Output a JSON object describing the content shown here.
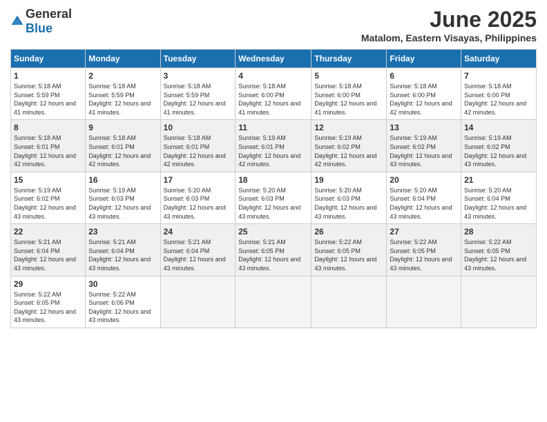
{
  "header": {
    "logo_general": "General",
    "logo_blue": "Blue",
    "month_year": "June 2025",
    "location": "Matalom, Eastern Visayas, Philippines"
  },
  "weekdays": [
    "Sunday",
    "Monday",
    "Tuesday",
    "Wednesday",
    "Thursday",
    "Friday",
    "Saturday"
  ],
  "weeks": [
    [
      {
        "day": "1",
        "sunrise": "5:18 AM",
        "sunset": "5:59 PM",
        "daylight": "12 hours and 41 minutes."
      },
      {
        "day": "2",
        "sunrise": "5:18 AM",
        "sunset": "5:59 PM",
        "daylight": "12 hours and 41 minutes."
      },
      {
        "day": "3",
        "sunrise": "5:18 AM",
        "sunset": "5:59 PM",
        "daylight": "12 hours and 41 minutes."
      },
      {
        "day": "4",
        "sunrise": "5:18 AM",
        "sunset": "6:00 PM",
        "daylight": "12 hours and 41 minutes."
      },
      {
        "day": "5",
        "sunrise": "5:18 AM",
        "sunset": "6:00 PM",
        "daylight": "12 hours and 41 minutes."
      },
      {
        "day": "6",
        "sunrise": "5:18 AM",
        "sunset": "6:00 PM",
        "daylight": "12 hours and 42 minutes."
      },
      {
        "day": "7",
        "sunrise": "5:18 AM",
        "sunset": "6:00 PM",
        "daylight": "12 hours and 42 minutes."
      }
    ],
    [
      {
        "day": "8",
        "sunrise": "5:18 AM",
        "sunset": "6:01 PM",
        "daylight": "12 hours and 42 minutes."
      },
      {
        "day": "9",
        "sunrise": "5:18 AM",
        "sunset": "6:01 PM",
        "daylight": "12 hours and 42 minutes."
      },
      {
        "day": "10",
        "sunrise": "5:18 AM",
        "sunset": "6:01 PM",
        "daylight": "12 hours and 42 minutes."
      },
      {
        "day": "11",
        "sunrise": "5:19 AM",
        "sunset": "6:01 PM",
        "daylight": "12 hours and 42 minutes."
      },
      {
        "day": "12",
        "sunrise": "5:19 AM",
        "sunset": "6:02 PM",
        "daylight": "12 hours and 42 minutes."
      },
      {
        "day": "13",
        "sunrise": "5:19 AM",
        "sunset": "6:02 PM",
        "daylight": "12 hours and 43 minutes."
      },
      {
        "day": "14",
        "sunrise": "5:19 AM",
        "sunset": "6:02 PM",
        "daylight": "12 hours and 43 minutes."
      }
    ],
    [
      {
        "day": "15",
        "sunrise": "5:19 AM",
        "sunset": "6:02 PM",
        "daylight": "12 hours and 43 minutes."
      },
      {
        "day": "16",
        "sunrise": "5:19 AM",
        "sunset": "6:03 PM",
        "daylight": "12 hours and 43 minutes."
      },
      {
        "day": "17",
        "sunrise": "5:20 AM",
        "sunset": "6:03 PM",
        "daylight": "12 hours and 43 minutes."
      },
      {
        "day": "18",
        "sunrise": "5:20 AM",
        "sunset": "6:03 PM",
        "daylight": "12 hours and 43 minutes."
      },
      {
        "day": "19",
        "sunrise": "5:20 AM",
        "sunset": "6:03 PM",
        "daylight": "12 hours and 43 minutes."
      },
      {
        "day": "20",
        "sunrise": "5:20 AM",
        "sunset": "6:04 PM",
        "daylight": "12 hours and 43 minutes."
      },
      {
        "day": "21",
        "sunrise": "5:20 AM",
        "sunset": "6:04 PM",
        "daylight": "12 hours and 43 minutes."
      }
    ],
    [
      {
        "day": "22",
        "sunrise": "5:21 AM",
        "sunset": "6:04 PM",
        "daylight": "12 hours and 43 minutes."
      },
      {
        "day": "23",
        "sunrise": "5:21 AM",
        "sunset": "6:04 PM",
        "daylight": "12 hours and 43 minutes."
      },
      {
        "day": "24",
        "sunrise": "5:21 AM",
        "sunset": "6:04 PM",
        "daylight": "12 hours and 43 minutes."
      },
      {
        "day": "25",
        "sunrise": "5:21 AM",
        "sunset": "6:05 PM",
        "daylight": "12 hours and 43 minutes."
      },
      {
        "day": "26",
        "sunrise": "5:22 AM",
        "sunset": "6:05 PM",
        "daylight": "12 hours and 43 minutes."
      },
      {
        "day": "27",
        "sunrise": "5:22 AM",
        "sunset": "6:05 PM",
        "daylight": "12 hours and 43 minutes."
      },
      {
        "day": "28",
        "sunrise": "5:22 AM",
        "sunset": "6:05 PM",
        "daylight": "12 hours and 43 minutes."
      }
    ],
    [
      {
        "day": "29",
        "sunrise": "5:22 AM",
        "sunset": "6:05 PM",
        "daylight": "12 hours and 43 minutes."
      },
      {
        "day": "30",
        "sunrise": "5:22 AM",
        "sunset": "6:06 PM",
        "daylight": "12 hours and 43 minutes."
      },
      null,
      null,
      null,
      null,
      null
    ]
  ],
  "labels": {
    "sunrise": "Sunrise:",
    "sunset": "Sunset:",
    "daylight": "Daylight:"
  }
}
